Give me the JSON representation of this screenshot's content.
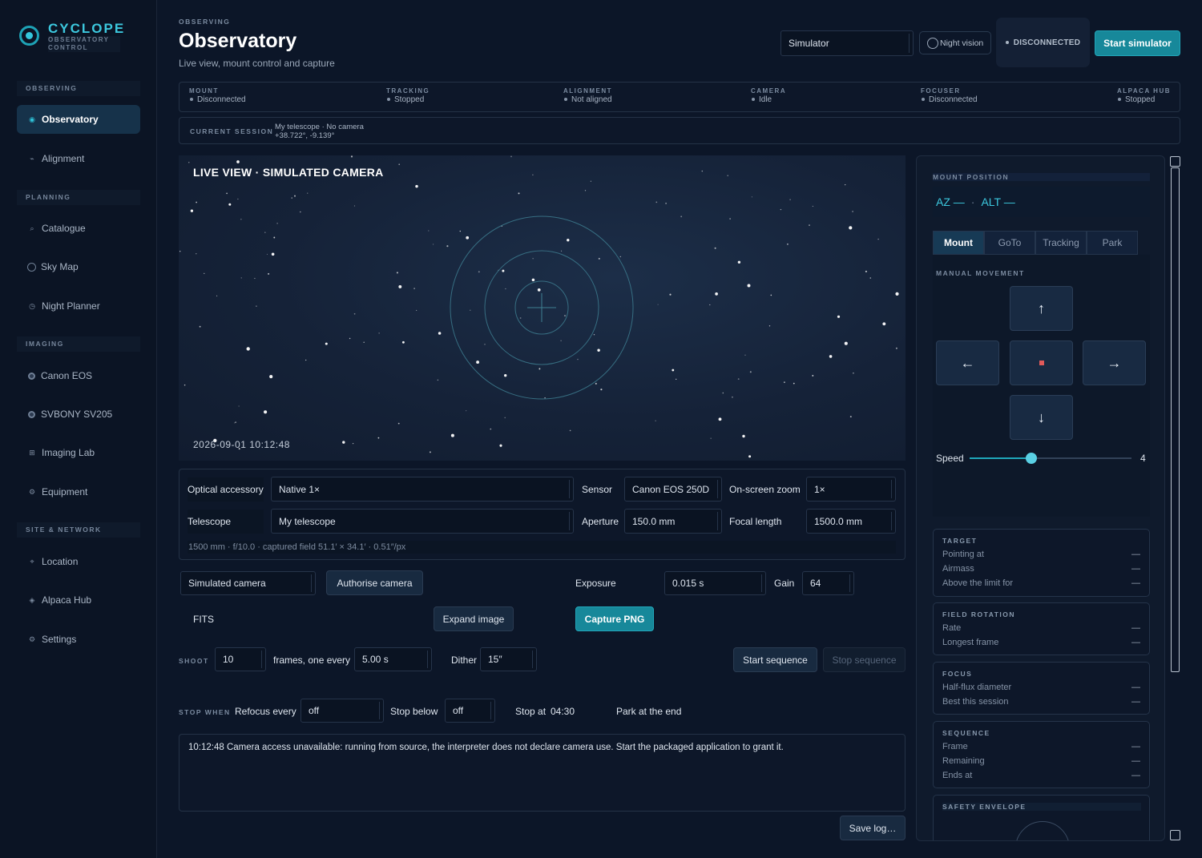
{
  "brand": {
    "name": "CYCLOPE",
    "sub": "OBSERVATORY CONTROL"
  },
  "nav": {
    "sections": [
      "OBSERVING",
      "PLANNING",
      "IMAGING",
      "SITE & NETWORK"
    ],
    "items": [
      {
        "label": "Observatory",
        "icon": "target-icon"
      },
      {
        "label": "Alignment",
        "icon": "dash-icon"
      },
      {
        "label": "Catalogue",
        "icon": "catalogue-icon"
      },
      {
        "label": "Sky Map",
        "icon": "ring-icon"
      },
      {
        "label": "Night Planner",
        "icon": "clock-icon"
      },
      {
        "label": "Canon EOS",
        "icon": "camera-icon"
      },
      {
        "label": "SVBONY SV205",
        "icon": "camera-icon"
      },
      {
        "label": "Imaging Lab",
        "icon": "grid-icon"
      },
      {
        "label": "Equipment",
        "icon": "gear-icon"
      },
      {
        "label": "Location",
        "icon": "pin-icon"
      },
      {
        "label": "Alpaca Hub",
        "icon": "diamond-icon"
      },
      {
        "label": "Settings",
        "icon": "gear-icon"
      }
    ]
  },
  "header": {
    "eyebrow": "OBSERVING",
    "title": "Observatory",
    "subtitle": "Live view, mount control and capture",
    "driver": "Simulator",
    "night_vision": "Night vision",
    "connection": "DISCONNECTED",
    "start_label": "Start simulator"
  },
  "status": [
    {
      "title": "MOUNT",
      "value": "Disconnected"
    },
    {
      "title": "TRACKING",
      "value": "Stopped"
    },
    {
      "title": "ALIGNMENT",
      "value": "Not aligned"
    },
    {
      "title": "CAMERA",
      "value": "Idle"
    },
    {
      "title": "FOCUSER",
      "value": "Disconnected"
    },
    {
      "title": "ALPACA HUB",
      "value": "Stopped"
    }
  ],
  "session": {
    "label": "CURRENT SESSION",
    "line1": "My telescope · No camera",
    "line2": "+38.722°, -9.139°"
  },
  "live": {
    "title": "LIVE VIEW · SIMULATED CAMERA",
    "timestamp": "2026-09-01  10:12:48"
  },
  "optics": {
    "accessory_label": "Optical accessory",
    "accessory": "Native 1×",
    "sensor_label": "Sensor",
    "sensor": "Canon EOS 250D",
    "zoom_label": "On-screen zoom",
    "zoom": "1×",
    "telescope_label": "Telescope",
    "telescope": "My telescope",
    "aperture_label": "Aperture",
    "aperture": "150.0 mm",
    "focal_label": "Focal length",
    "focal": "1500.0 mm",
    "summary": "1500 mm · f/10.0 · captured field 51.1′ × 34.1′ · 0.51″/px"
  },
  "capture": {
    "camera": "Simulated camera",
    "authorise": "Authorise camera",
    "exposure_label": "Exposure",
    "exposure": "0.015 s",
    "gain_label": "Gain",
    "gain": "64",
    "format": "FITS",
    "expand": "Expand image",
    "capture_png": "Capture PNG"
  },
  "sequence": {
    "shoot_label": "SHOOT",
    "frames": "10",
    "frames_text": "frames, one every",
    "interval": "5.00 s",
    "dither_label": "Dither",
    "dither": "15″",
    "start": "Start sequence",
    "stop": "Stop sequence",
    "stop_when": "STOP WHEN",
    "refocus_label": "Refocus every",
    "refocus": "off",
    "below_label": "Stop below",
    "below": "off",
    "stop_at_label": "Stop at",
    "stop_at": "04:30",
    "park_label": "Park at the end"
  },
  "log": {
    "line": "10:12:48  Camera access unavailable: running from source, the interpreter does not declare camera use. Start the packaged application to grant it.",
    "save": "Save log…"
  },
  "mount": {
    "position_title": "MOUNT POSITION",
    "az": "AZ —",
    "alt": "ALT —",
    "tabs": [
      "Mount",
      "GoTo",
      "Tracking",
      "Park"
    ],
    "manual_title": "MANUAL MOVEMENT",
    "speed_label": "Speed",
    "speed": "4",
    "speed_fraction": 0.38
  },
  "cards": {
    "target": {
      "title": "TARGET",
      "rows": [
        [
          "Pointing at",
          "—"
        ],
        [
          "Airmass",
          "—"
        ],
        [
          "Above the limit for",
          "—"
        ]
      ]
    },
    "rotation": {
      "title": "FIELD ROTATION",
      "rows": [
        [
          "Rate",
          "—"
        ],
        [
          "Longest frame",
          "—"
        ]
      ]
    },
    "focus": {
      "title": "FOCUS",
      "rows": [
        [
          "Half-flux diameter",
          "—"
        ],
        [
          "Best this session",
          "—"
        ]
      ]
    },
    "sequence": {
      "title": "SEQUENCE",
      "rows": [
        [
          "Frame",
          "—"
        ],
        [
          "Remaining",
          "—"
        ],
        [
          "Ends at",
          "—"
        ]
      ]
    },
    "safety": {
      "title": "SAFETY ENVELOPE"
    }
  },
  "colors": {
    "accent": "#1fa8bb",
    "background": "#0c1628",
    "stop": "#e05a5a"
  }
}
